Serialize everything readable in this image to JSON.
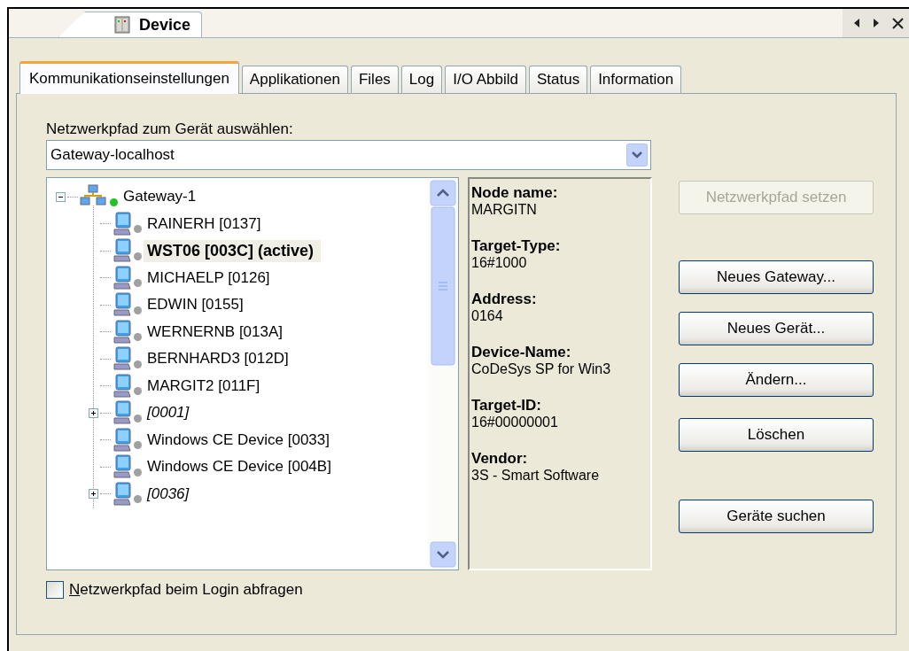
{
  "document_tab": {
    "title": "Device"
  },
  "tabs": [
    {
      "label": "Kommunikationseinstellungen",
      "selected": true
    },
    {
      "label": "Applikationen",
      "selected": false
    },
    {
      "label": "Files",
      "selected": false
    },
    {
      "label": "Log",
      "selected": false
    },
    {
      "label": "I/O Abbild",
      "selected": false
    },
    {
      "label": "Status",
      "selected": false
    },
    {
      "label": "Information",
      "selected": false
    }
  ],
  "path_label": "Netzwerkpfad zum Gerät auswählen:",
  "path_select": {
    "value": "Gateway-localhost"
  },
  "tree": [
    {
      "label": "Gateway-1",
      "kind": "gateway",
      "color": "#22c322",
      "expanded": true,
      "selected": false,
      "children": [
        {
          "label": "RAINERH [0137]",
          "kind": "device",
          "color": "#a0a0a0",
          "selected": false
        },
        {
          "label": "WST06 [003C] (active)",
          "kind": "device",
          "color": "#a0a0a0",
          "selected": true
        },
        {
          "label": "MICHAELP [0126]",
          "kind": "device",
          "color": "#a0a0a0",
          "selected": false
        },
        {
          "label": "EDWIN [0155]",
          "kind": "device",
          "color": "#a0a0a0",
          "selected": false
        },
        {
          "label": "WERNERNB [013A]",
          "kind": "device",
          "color": "#a0a0a0",
          "selected": false
        },
        {
          "label": "BERNHARD3 [012D]",
          "kind": "device",
          "color": "#a0a0a0",
          "selected": false
        },
        {
          "label": "MARGIT2 [011F]",
          "kind": "device",
          "color": "#a0a0a0",
          "selected": false
        },
        {
          "label": "[0001]",
          "kind": "unnamed",
          "color": "#a0a0a0",
          "selected": false,
          "expanded": false
        },
        {
          "label": "Windows CE Device [0033]",
          "kind": "device",
          "color": "#a0a0a0",
          "selected": false
        },
        {
          "label": "Windows CE Device [004B]",
          "kind": "device",
          "color": "#a0a0a0",
          "selected": false
        },
        {
          "label": "[0036]",
          "kind": "unnamed",
          "color": "#a0a0a0",
          "selected": false,
          "expanded": false
        }
      ]
    }
  ],
  "info": [
    {
      "label": "Node name:",
      "value": "MARGITN"
    },
    {
      "label": "Target-Type:",
      "value": "16#1000"
    },
    {
      "label": "Address:",
      "value": "0164"
    },
    {
      "label": "Device-Name:",
      "value": "CoDeSys SP for Win3"
    },
    {
      "label": "Target-ID:",
      "value": "16#00000001"
    },
    {
      "label": "Vendor:",
      "value": "3S - Smart Software"
    }
  ],
  "buttons": [
    {
      "label": "Netzwerkpfad setzen",
      "disabled": true
    },
    {
      "label": "Neues Gateway...",
      "disabled": false
    },
    {
      "label": "Neues Gerät...",
      "disabled": false
    },
    {
      "label": "Ändern...",
      "disabled": false
    },
    {
      "label": "Löschen",
      "disabled": false
    },
    {
      "label": "Geräte suchen",
      "disabled": false
    }
  ],
  "login_check": {
    "label": "Netzwerkpfad beim Login abfragen",
    "checked": false
  }
}
